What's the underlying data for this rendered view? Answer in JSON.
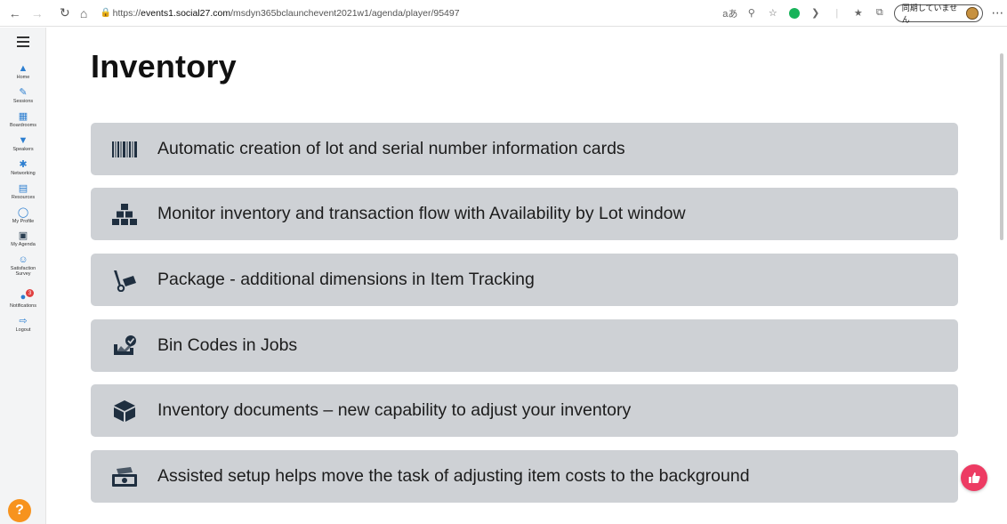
{
  "browser": {
    "url_prefix": "https://",
    "url_host": "events1.social27.com",
    "url_path": "/msdyn365bclaunchevent2021w1/agenda/player/95497",
    "sync_label": "同期していません",
    "reader_label": "aあ"
  },
  "sidebar": {
    "items": [
      {
        "label": "Home",
        "icon": "home-icon"
      },
      {
        "label": "Sessions",
        "icon": "pencil-icon"
      },
      {
        "label": "Boardrooms",
        "icon": "boardroom-icon"
      },
      {
        "label": "Speakers",
        "icon": "speaker-icon"
      },
      {
        "label": "Networking",
        "icon": "network-icon"
      },
      {
        "label": "Resources",
        "icon": "resources-icon"
      },
      {
        "label": "My Profile",
        "icon": "profile-icon"
      },
      {
        "label": "My Agenda",
        "icon": "calendar-icon"
      },
      {
        "label": "Satisfaction Survey",
        "icon": "survey-icon"
      },
      {
        "label": "Notifications",
        "icon": "bell-icon",
        "badge": "3"
      },
      {
        "label": "Logout",
        "icon": "logout-icon"
      }
    ],
    "help_label": "?"
  },
  "main": {
    "title": "Inventory",
    "cards": [
      {
        "text": "Automatic creation of lot and serial number information cards",
        "icon": "barcode-icon"
      },
      {
        "text": "Monitor inventory and transaction flow with Availability by Lot window",
        "icon": "boxes-icon"
      },
      {
        "text": "Package - additional dimensions in Item Tracking",
        "icon": "dolly-icon"
      },
      {
        "text": "Bin Codes in Jobs",
        "icon": "bin-check-icon"
      },
      {
        "text": "Inventory documents – new capability to adjust your inventory",
        "icon": "box-icon"
      },
      {
        "text": "Assisted setup helps move the task of adjusting item costs to the background",
        "icon": "money-icon"
      }
    ]
  },
  "colors": {
    "card_bg": "#ced1d5",
    "rail_icon": "#2c7ed0",
    "like_button": "#ed3b63",
    "help_button": "#f7931e"
  }
}
